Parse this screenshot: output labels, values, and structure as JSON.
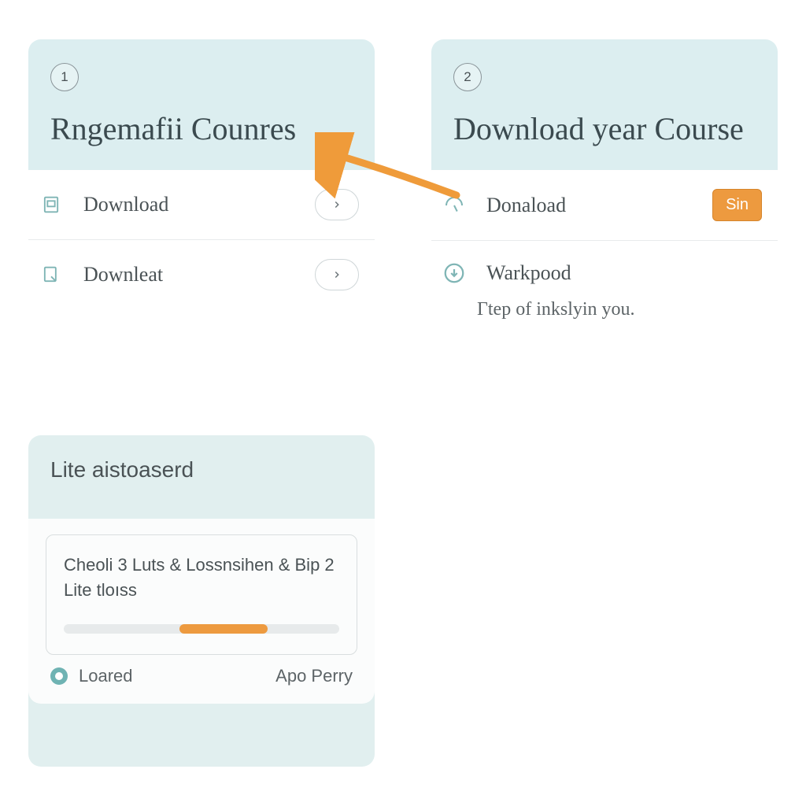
{
  "card1": {
    "step": "1",
    "title": "Rngemafii Counres",
    "items": [
      {
        "label": "Download"
      },
      {
        "label": "Downleat"
      }
    ]
  },
  "card2": {
    "step": "2",
    "title": "Download year Course",
    "items": [
      {
        "label": "Donaload",
        "action": "Sin"
      },
      {
        "label": "Warkpood",
        "sub": "Гtep of inkslyin you."
      }
    ]
  },
  "lite": {
    "title": "Lite aistoaserd",
    "content": "Cheoli 3 Luts & Lossnsihen & Bip 2 Lite tloıss",
    "footer_left": "Loared",
    "footer_right": "Apo Perry"
  }
}
